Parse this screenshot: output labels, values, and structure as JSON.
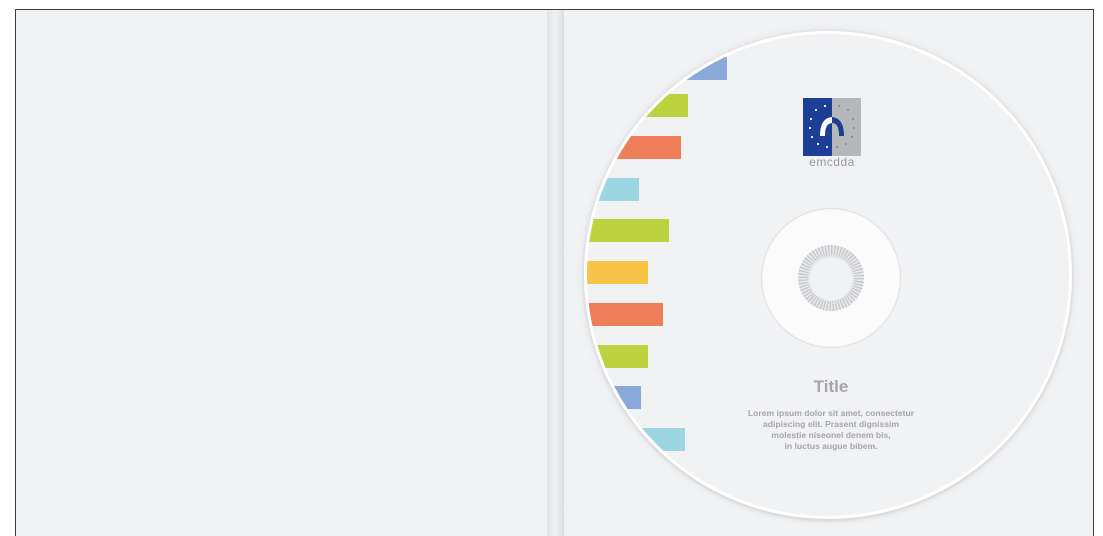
{
  "logo": {
    "name": "emcdda",
    "icon": "emcdda-logo-icon",
    "colors": {
      "blue": "#1c3f95",
      "grey": "#b6b7bb"
    }
  },
  "disc": {
    "title": "Title",
    "body_lines": [
      "Lorem ipsum dolor sit amet, consectetur",
      "adipiscing elit. Prasent dignissim",
      "molestie niseonel denem bis,",
      "in luctus augue bibem."
    ]
  },
  "palette": {
    "blue": "#8aa8d8",
    "green": "#bdd23f",
    "orange": "#ee7e5a",
    "cyan": "#9dd5e3",
    "yellow": "#f7c448"
  }
}
